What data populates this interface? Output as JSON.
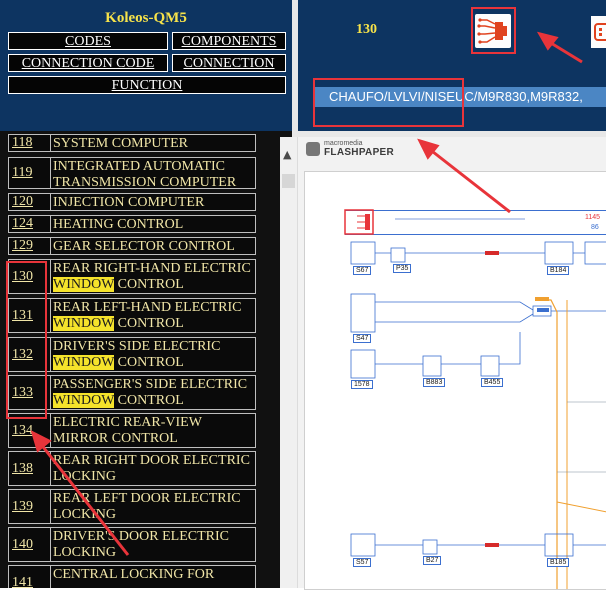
{
  "app": {
    "title": "Koleos-QM5"
  },
  "nav": {
    "codes": "CODES",
    "components": "COMPONENTS",
    "connection_code": "CONNECTION CODE",
    "connection": "CONNECTION",
    "function": "FUNCTION"
  },
  "header": {
    "page_number": "130",
    "code_bar": "CHAUFO/LVLVI/NISEUC/M9R830,M9R832,"
  },
  "viewer": {
    "flash_small": "macromedia",
    "flash_big": "FLASHPAPER",
    "diagram_ref_top": "1145",
    "diagram_ref_small": "86"
  },
  "functions": [
    {
      "code": "118",
      "label": "SYSTEM COMPUTER",
      "hl": ""
    },
    {
      "code": "119",
      "label": "INTEGRATED AUTOMATIC TRANSMISSION COMPUTER",
      "hl": ""
    },
    {
      "code": "120",
      "label": "INJECTION COMPUTER",
      "hl": ""
    },
    {
      "code": "124",
      "label": "HEATING CONTROL",
      "hl": ""
    },
    {
      "code": "129",
      "label": "GEAR SELECTOR CONTROL",
      "hl": ""
    },
    {
      "code": "130",
      "pre": "REAR RIGHT-HAND ELECTRIC ",
      "hl": "WINDOW",
      "post": " CONTROL"
    },
    {
      "code": "131",
      "pre": "REAR LEFT-HAND ELECTRIC ",
      "hl": "WINDOW",
      "post": " CONTROL"
    },
    {
      "code": "132",
      "pre": "DRIVER'S SIDE ELECTRIC ",
      "hl": "WINDOW",
      "post": " CONTROL"
    },
    {
      "code": "133",
      "pre": "PASSENGER'S SIDE ELECTRIC ",
      "hl": "WINDOW",
      "post": " CONTROL"
    },
    {
      "code": "134",
      "label": "ELECTRIC REAR-VIEW MIRROR CONTROL",
      "hl": ""
    },
    {
      "code": "138",
      "label": "REAR RIGHT DOOR ELECTRIC LOCKING",
      "hl": ""
    },
    {
      "code": "139",
      "label": "REAR LEFT DOOR ELECTRIC LOCKING",
      "hl": ""
    },
    {
      "code": "140",
      "label": "DRIVER'S DOOR ELECTRIC LOCKING",
      "hl": ""
    },
    {
      "code": "141",
      "label": "CENTRAL LOCKING FOR",
      "hl": ""
    }
  ],
  "diagram": {
    "labels": [
      "S67",
      "P35",
      "B184",
      "S47",
      "1578",
      "B883",
      "B455",
      "S57",
      "B27",
      "B185"
    ]
  },
  "colors": {
    "panel": "#0d3461",
    "title": "#f7e34a",
    "highlight": "#f5e32b",
    "annotation": "#e8343a",
    "code_bar": "#4b86c4"
  }
}
